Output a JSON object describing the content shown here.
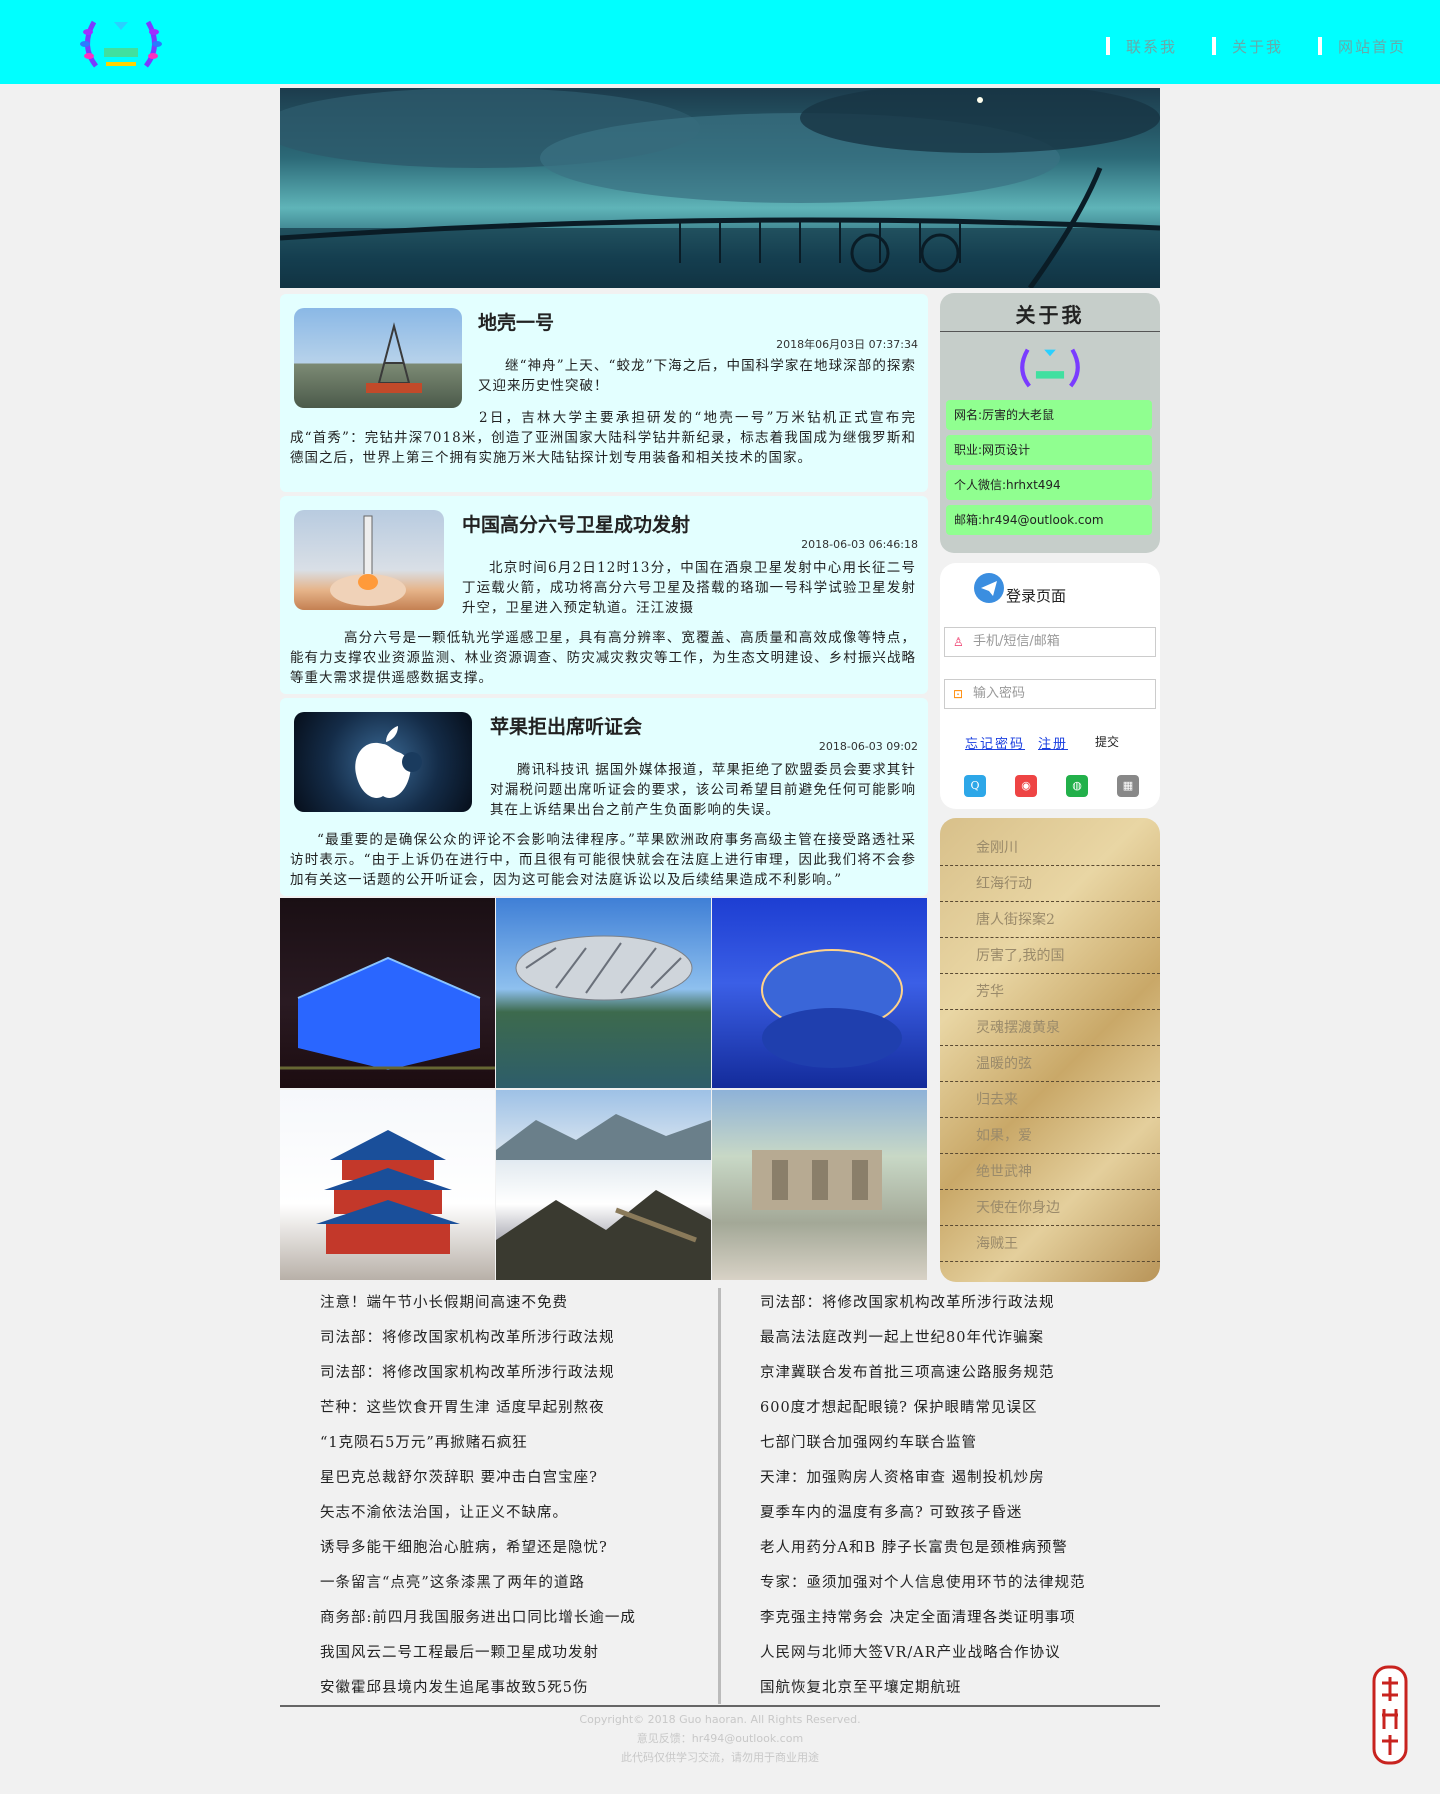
{
  "nav": {
    "items": [
      "联系我",
      "关于我",
      "网站首页"
    ]
  },
  "articles": [
    {
      "title": "地壳一号",
      "time": "2018年06月03日 07:37:34",
      "lead": "继“神舟”上天、“蛟龙”下海之后，中国科学家在地球深部的探索又迎来历史性突破！",
      "body": "2日，吉林大学主要承担研发的“地壳一号”万米钻机正式宣布完成“首秀”：完钻井深7018米，创造了亚洲国家大陆科学钻井新纪录，标志着我国成为继俄罗斯和德国之后，世界上第三个拥有实施万米大陆钻探计划专用装备和相关技术的国家。"
    },
    {
      "title": "中国高分六号卫星成功发射",
      "time": "2018-06-03 06:46:18",
      "lead": "北京时间6月2日12时13分，中国在酒泉卫星发射中心用长征二号丁运载火箭，成功将高分六号卫星及搭载的珞珈一号科学试验卫星发射升空，卫星进入预定轨道。汪江波摄",
      "body": "高分六号是一颗低轨光学遥感卫星，具有高分辨率、宽覆盖、高质量和高效成像等特点，能有力支撑农业资源监测、林业资源调查、防灾减灾救灾等工作，为生态文明建设、乡村振兴战略等重大需求提供遥感数据支撑。"
    },
    {
      "title": "苹果拒出席听证会",
      "time": "2018-06-03 09:02",
      "lead": "腾讯科技讯 据国外媒体报道，苹果拒绝了欧盟委员会要求其针对漏税问题出席听证会的要求，该公司希望目前避免任何可能影响其在上诉结果出台之前产生负面影响的失误。",
      "body": "“最重要的是确保公众的评论不会影响法律程序。”苹果欧洲政府事务高级主管在接受路透社采访时表示。“由于上诉仍在进行中，而且很有可能很快就会在法庭上进行审理，因此我们将不会参加有关这一话题的公开听证会，因为这可能会对法庭诉讼以及后续结果造成不利影响。”"
    }
  ],
  "about": {
    "title": "关于我",
    "items": [
      "网名:厉害的大老鼠",
      "职业:网页设计",
      "个人微信:hrhxt494",
      "邮箱:hr494@outlook.com"
    ]
  },
  "login": {
    "title": "登录页面",
    "user_placeholder": "手机/短信/邮箱",
    "pass_placeholder": "输入密码",
    "forgot": "忘记密码",
    "register": "注册",
    "submit": "提交"
  },
  "movies": [
    "金刚川",
    "红海行动",
    "唐人街探案2",
    "厉害了,我的国",
    "芳华",
    "灵魂摆渡黄泉",
    "温暖的弦",
    "归去来",
    "如果，爱",
    "绝世武神",
    "天使在你身边",
    "海贼王"
  ],
  "news_left": [
    "注意！端午节小长假期间高速不免费",
    "司法部：将修改国家机构改革所涉行政法规",
    "司法部：将修改国家机构改革所涉行政法规",
    "芒种：这些饮食开胃生津 适度早起别熬夜",
    "“1克陨石5万元”再掀赌石疯狂",
    "星巴克总裁舒尔茨辞职 要冲击白宫宝座?",
    "矢志不渝依法治国，让正义不缺席。",
    "诱导多能干细胞治心脏病，希望还是隐忧?",
    "一条留言“点亮”这条漆黑了两年的道路",
    "商务部:前四月我国服务进出口同比增长逾一成",
    "我国风云二号工程最后一颗卫星成功发射",
    "安徽霍邱县境内发生追尾事故致5死5伤"
  ],
  "news_right": [
    "司法部：将修改国家机构改革所涉行政法规",
    "最高法法庭改判一起上世纪80年代诈骗案",
    "京津冀联合发布首批三项高速公路服务规范",
    "600度才想起配眼镜? 保护眼睛常见误区",
    "七部门联合加强网约车联合监管",
    "天津：加强购房人资格审查 遏制投机炒房",
    "夏季车内的温度有多高? 可致孩子昏迷",
    "老人用药分A和B 脖子长富贵包是颈椎病预警",
    "专家：亟须加强对个人信息使用环节的法律规范",
    "李克强主持常务会 决定全面清理各类证明事项",
    "人民网与北师大签VR/AR产业战略合作协议",
    "国航恢复北京至平壤定期航班"
  ],
  "footer": {
    "copyright": "Copyright© 2018 Guo haoran. All Rights Reserved.",
    "feedback": "意见反馈：hr494@outlook.com",
    "note": "此代码仅供学习交流，请勿用于商业用途"
  },
  "colors": {
    "topbar": "#00ffff",
    "article_bg": "#e3ffff",
    "about_item": "#90ff90",
    "about_bg": "#c6ceca"
  }
}
